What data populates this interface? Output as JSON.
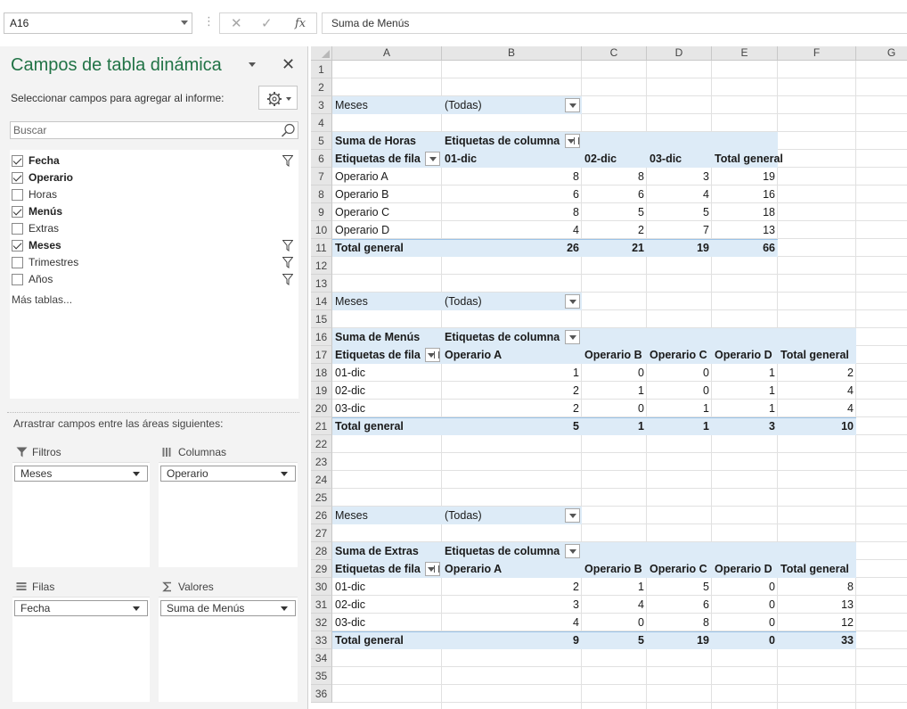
{
  "formula_bar": {
    "name_box": "A16",
    "cancel_icon": "✕",
    "enter_icon": "✓",
    "fx_label": "fx",
    "formula": "Suma de Menús"
  },
  "pivot_panel": {
    "title": "Campos de tabla dinámica",
    "subtitle": "Seleccionar campos para agregar al informe:",
    "search_placeholder": "Buscar",
    "fields": [
      {
        "label": "Fecha",
        "checked": true,
        "bold": true,
        "filter": true
      },
      {
        "label": "Operario",
        "checked": true,
        "bold": true,
        "filter": false
      },
      {
        "label": "Horas",
        "checked": false,
        "bold": false,
        "filter": false
      },
      {
        "label": "Menús",
        "checked": true,
        "bold": true,
        "filter": false
      },
      {
        "label": "Extras",
        "checked": false,
        "bold": false,
        "filter": false
      },
      {
        "label": "Meses",
        "checked": true,
        "bold": true,
        "filter": true
      },
      {
        "label": "Trimestres",
        "checked": false,
        "bold": false,
        "filter": true
      },
      {
        "label": "Años",
        "checked": false,
        "bold": false,
        "filter": true
      }
    ],
    "more_tables": "Más tablas...",
    "drag_text": "Arrastrar campos entre las áreas siguientes:",
    "areas": {
      "filters": {
        "label": "Filtros",
        "item": "Meses"
      },
      "columns": {
        "label": "Columnas",
        "item": "Operario"
      },
      "rows": {
        "label": "Filas",
        "item": "Fecha"
      },
      "values": {
        "label": "Valores",
        "item": "Suma de Menús"
      }
    }
  },
  "grid": {
    "columns": [
      "A",
      "B",
      "C",
      "D",
      "E",
      "F",
      "G"
    ],
    "rows": [
      "1",
      "2",
      "3",
      "4",
      "5",
      "6",
      "7",
      "8",
      "9",
      "10",
      "11",
      "12",
      "13",
      "14",
      "15",
      "16",
      "17",
      "18",
      "19",
      "20",
      "21",
      "22",
      "23",
      "24",
      "25",
      "26",
      "27",
      "28",
      "29",
      "30",
      "31",
      "32",
      "33",
      "34",
      "35",
      "36"
    ],
    "filter_label": "Meses",
    "filter_value": "(Todas)",
    "pivot1": {
      "value_field": "Suma de Horas",
      "col_labels": "Etiquetas de columna",
      "row_labels": "Etiquetas de fila",
      "headers": [
        "01-dic",
        "02-dic",
        "03-dic",
        "Total general"
      ],
      "rows": [
        {
          "label": "Operario A",
          "values": [
            "8",
            "8",
            "3",
            "19"
          ]
        },
        {
          "label": "Operario B",
          "values": [
            "6",
            "6",
            "4",
            "16"
          ]
        },
        {
          "label": "Operario C",
          "values": [
            "8",
            "5",
            "5",
            "18"
          ]
        },
        {
          "label": "Operario D",
          "values": [
            "4",
            "2",
            "7",
            "13"
          ]
        }
      ],
      "total": {
        "label": "Total general",
        "values": [
          "26",
          "21",
          "19",
          "66"
        ]
      }
    },
    "pivot2": {
      "value_field": "Suma de Menús",
      "col_labels": "Etiquetas de columna",
      "row_labels": "Etiquetas de fila",
      "headers": [
        "Operario A",
        "Operario B",
        "Operario C",
        "Operario D",
        "Total general"
      ],
      "rows": [
        {
          "label": "01-dic",
          "values": [
            "1",
            "0",
            "0",
            "1",
            "2"
          ]
        },
        {
          "label": "02-dic",
          "values": [
            "2",
            "1",
            "0",
            "1",
            "4"
          ]
        },
        {
          "label": "03-dic",
          "values": [
            "2",
            "0",
            "1",
            "1",
            "4"
          ]
        }
      ],
      "total": {
        "label": "Total general",
        "values": [
          "5",
          "1",
          "1",
          "3",
          "10"
        ]
      }
    },
    "pivot3": {
      "value_field": "Suma de Extras",
      "col_labels": "Etiquetas de columna",
      "row_labels": "Etiquetas de fila",
      "headers": [
        "Operario A",
        "Operario B",
        "Operario C",
        "Operario D",
        "Total general"
      ],
      "rows": [
        {
          "label": "01-dic",
          "values": [
            "2",
            "1",
            "5",
            "0",
            "8"
          ]
        },
        {
          "label": "02-dic",
          "values": [
            "3",
            "4",
            "6",
            "0",
            "13"
          ]
        },
        {
          "label": "03-dic",
          "values": [
            "4",
            "0",
            "8",
            "0",
            "12"
          ]
        }
      ],
      "total": {
        "label": "Total general",
        "values": [
          "9",
          "5",
          "19",
          "0",
          "33"
        ]
      }
    }
  },
  "colors": {
    "accent": "#217346",
    "pivot_band": "#ddebf7",
    "pivot_line": "#9bc2e6"
  }
}
